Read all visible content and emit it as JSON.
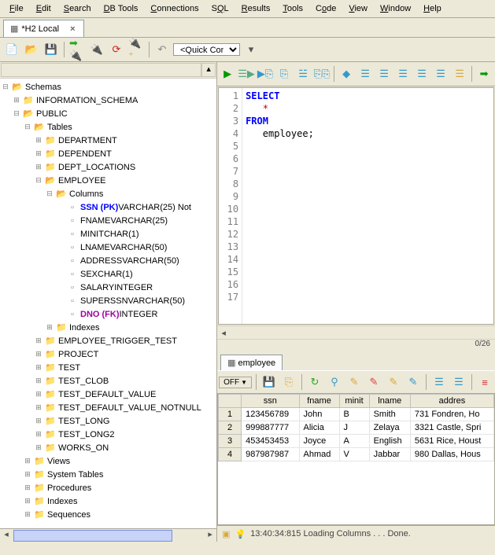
{
  "menu": {
    "file": "File",
    "edit": "Edit",
    "search": "Search",
    "dbtools": "DB Tools",
    "connections": "Connections",
    "sql": "SQL",
    "results": "Results",
    "tools": "Tools",
    "code": "Code",
    "view": "View",
    "window": "Window",
    "help": "Help"
  },
  "tab": {
    "title": "*H2 Local"
  },
  "quickconnect": "<Quick Connect>",
  "tree": {
    "root": "Schemas",
    "infoschema": "INFORMATION_SCHEMA",
    "public": "PUBLIC",
    "tables": "Tables",
    "department": "DEPARTMENT",
    "dependent": "DEPENDENT",
    "deptloc": "DEPT_LOCATIONS",
    "employee": "EMPLOYEE",
    "columns": "Columns",
    "ssn_k": "SSN (PK)",
    "ssn_t": " VARCHAR(25) Not",
    "fname_k": "FNAME",
    "fname_t": " VARCHAR(25)",
    "minit_k": "MINIT",
    "minit_t": " CHAR(1)",
    "lname_k": "LNAME",
    "lname_t": " VARCHAR(50)",
    "address_k": "ADDRESS",
    "address_t": " VARCHAR(50)",
    "sex_k": "SEX",
    "sex_t": " CHAR(1)",
    "salary_k": "SALARY",
    "salary_t": " INTEGER",
    "superssn_k": "SUPERSSN",
    "superssn_t": " VARCHAR(50)",
    "dno_k": "DNO (FK)",
    "dno_t": " INTEGER",
    "indexes": "Indexes",
    "emptrig": "EMPLOYEE_TRIGGER_TEST",
    "project": "PROJECT",
    "test": "TEST",
    "testclob": "TEST_CLOB",
    "testdef": "TEST_DEFAULT_VALUE",
    "testdefnn": "TEST_DEFAULT_VALUE_NOTNULL",
    "testlong": "TEST_LONG",
    "testlong2": "TEST_LONG2",
    "workson": "WORKS_ON",
    "views": "Views",
    "systables": "System Tables",
    "procs": "Procedures",
    "idx": "Indexes",
    "seq": "Sequences"
  },
  "sql": {
    "l1": "SELECT",
    "l2": "*",
    "l3": "FROM",
    "l4": "employee;"
  },
  "counter": "0/26",
  "result_tab": "employee",
  "offbtn": "OFF",
  "cols": {
    "ssn": "ssn",
    "fname": "fname",
    "minit": "minit",
    "lname": "lname",
    "address": "addres"
  },
  "rows": [
    {
      "n": "1",
      "ssn": "123456789",
      "fname": "John",
      "minit": "B",
      "lname": "Smith",
      "address": "731 Fondren, Ho"
    },
    {
      "n": "2",
      "ssn": "999887777",
      "fname": "Alicia",
      "minit": "J",
      "lname": "Zelaya",
      "address": "3321 Castle, Spri"
    },
    {
      "n": "3",
      "ssn": "453453453",
      "fname": "Joyce",
      "minit": "A",
      "lname": "English",
      "address": "5631 Rice, Houst"
    },
    {
      "n": "4",
      "ssn": "987987987",
      "fname": "Ahmad",
      "minit": "V",
      "lname": "Jabbar",
      "address": "980 Dallas, Hous"
    }
  ],
  "status": "13:40:34:815 Loading Columns . . . Done."
}
